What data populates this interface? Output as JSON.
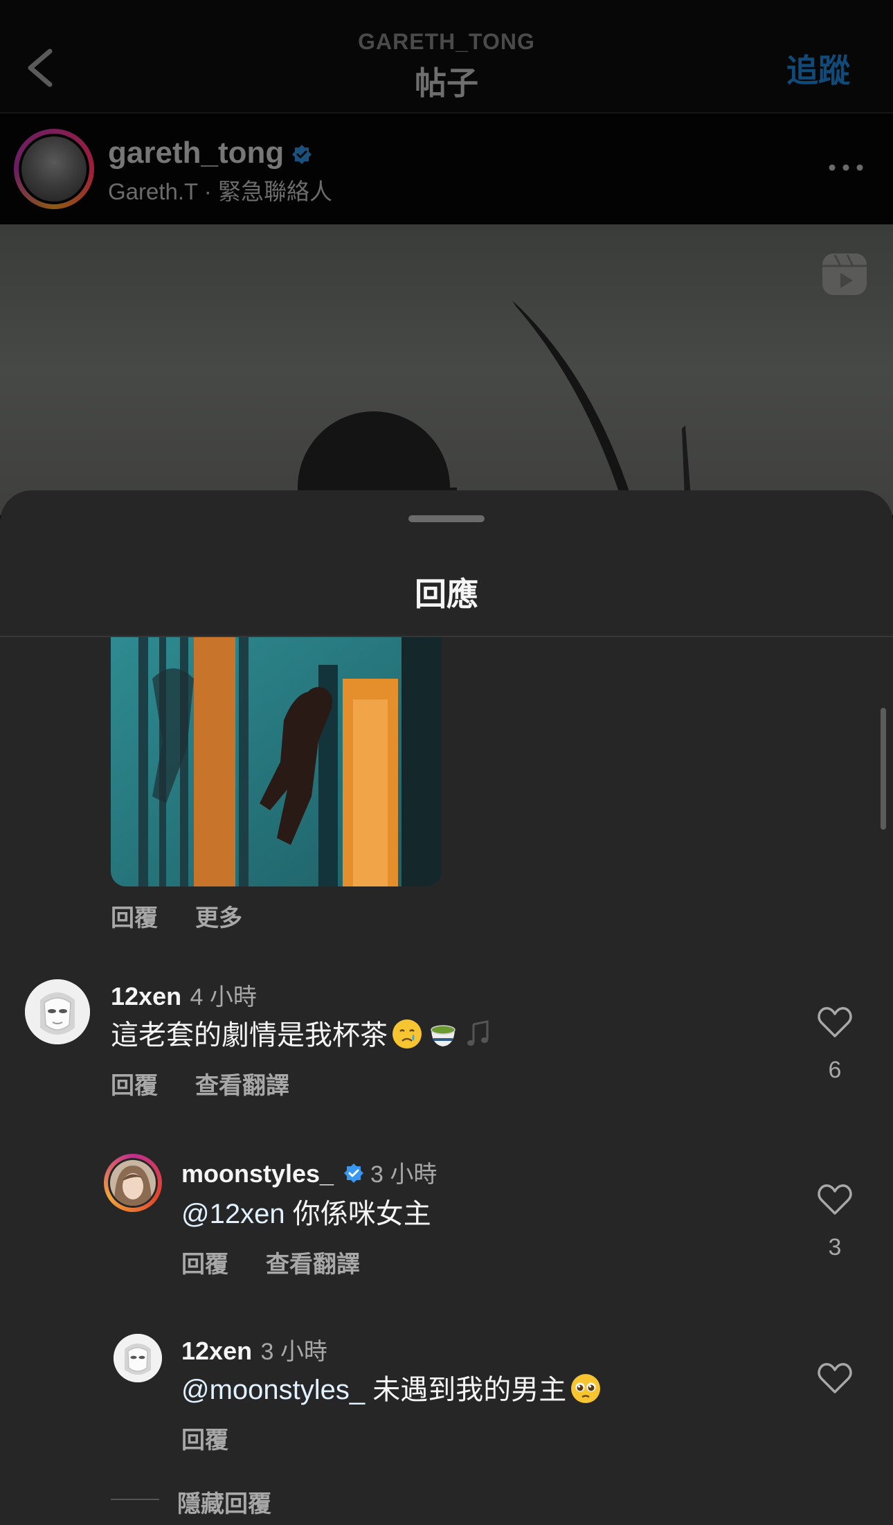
{
  "nav": {
    "username": "GARETH_TONG",
    "title": "帖子",
    "follow_label": "追蹤"
  },
  "post": {
    "username": "gareth_tong",
    "subtitle": "Gareth.T · 緊急聯絡人"
  },
  "sheet": {
    "title": "回應"
  },
  "gif_comment": {
    "reply_label": "回覆",
    "more_label": "更多"
  },
  "comments": [
    {
      "username": "12xen",
      "time": "4 小時",
      "text": "這老套的劇情是我杯茶",
      "emojis": [
        "crying-face",
        "teacup",
        "musical-notes"
      ],
      "reply_label": "回覆",
      "translate_label": "查看翻譯",
      "likes": "6"
    }
  ],
  "replies": [
    {
      "username": "moonstyles_",
      "verified": true,
      "time": "3 小時",
      "mention": "@12xen",
      "text": "你係咪女主",
      "reply_label": "回覆",
      "translate_label": "查看翻譯",
      "likes": "3"
    },
    {
      "username": "12xen",
      "time": "3 小時",
      "mention": "@moonstyles_",
      "text": "未遇到我的男主",
      "emojis": [
        "pleading-face"
      ],
      "reply_label": "回覆",
      "likes": ""
    }
  ],
  "hide_replies_label": "隱藏回覆",
  "colors": {
    "sheet_bg": "#262626",
    "verified_blue": "#3897f0",
    "secondary_text": "#a8a8a8"
  }
}
